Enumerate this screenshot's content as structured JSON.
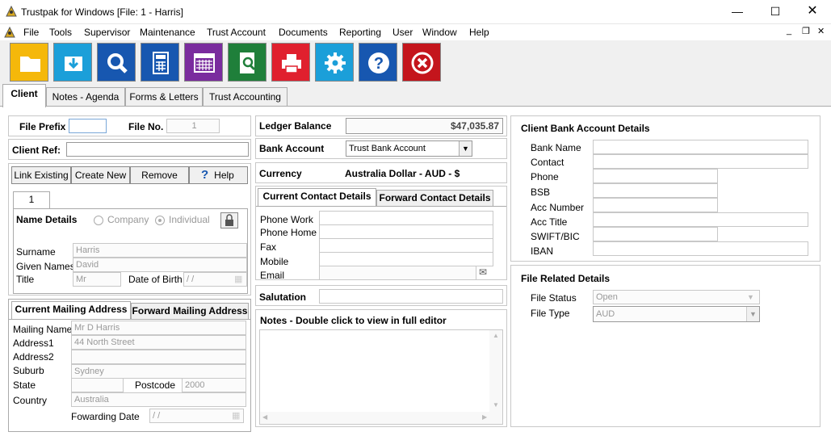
{
  "window": {
    "title": "Trustpak for Windows [File: 1 - Harris]"
  },
  "menu": [
    "File",
    "Tools",
    "Supervisor",
    "Maintenance",
    "Trust Account",
    "Documents",
    "Reporting",
    "User",
    "Window",
    "Help"
  ],
  "toolbar_icons": [
    "open-folder-icon",
    "download-icon",
    "search-icon",
    "calculator-icon",
    "calendar-icon",
    "document-search-icon",
    "printer-icon",
    "settings-icon",
    "help-icon",
    "exit-icon"
  ],
  "tabs": [
    "Client",
    "Notes - Agenda",
    "Forms & Letters",
    "Trust Accounting"
  ],
  "client": {
    "file_prefix_label": "File Prefix",
    "file_prefix": "",
    "file_no_label": "File No.",
    "file_no": "1",
    "client_ref_label": "Client Ref:",
    "client_ref": "",
    "buttons": {
      "link": "Link Existing",
      "create": "Create New",
      "remove": "Remove",
      "help": "Help"
    },
    "name_tab": "1",
    "name_details_label": "Name Details",
    "company_label": "Company",
    "individual_label": "Individual",
    "surname_label": "Surname",
    "surname": "Harris",
    "given_label": "Given Names",
    "given": "David",
    "title_label": "Title",
    "title": "Mr",
    "dob_label": "Date of Birth",
    "dob": " /  /"
  },
  "mailing": {
    "tab_current": "Current Mailing Address",
    "tab_forward": "Forward Mailing Address",
    "name_label": "Mailing Name",
    "name": "Mr D Harris",
    "address1_label": "Address1",
    "address1": "44 North Street",
    "address2_label": "Address2",
    "address2": "",
    "suburb_label": "Suburb",
    "suburb": "Sydney",
    "state_label": "State",
    "state": "",
    "postcode_label": "Postcode",
    "postcode": "2000",
    "country_label": "Country",
    "country": "Australia",
    "fwd_date_label": "Fowarding Date",
    "fwd_date": " /  /"
  },
  "ledger": {
    "balance_label": "Ledger Balance",
    "balance": "$47,035.87",
    "bank_label": "Bank Account",
    "bank": "Trust Bank Account",
    "currency_label": "Currency",
    "currency": "Australia Dollar - AUD - $"
  },
  "contact": {
    "tab_current": "Current Contact Details",
    "tab_forward": "Forward Contact Details",
    "phone_work_label": "Phone Work",
    "phone_home_label": "Phone Home",
    "fax_label": "Fax",
    "mobile_label": "Mobile",
    "email_label": "Email"
  },
  "salutation_label": "Salutation",
  "salutation": "",
  "notes_label": "Notes - Double click to view in full editor",
  "bank": {
    "title": "Client Bank Account Details",
    "bank_name_label": "Bank Name",
    "contact_label": "Contact",
    "phone_label": "Phone",
    "bsb_label": "BSB",
    "acc_number_label": "Acc Number",
    "acc_title_label": "Acc Title",
    "swift_label": "SWIFT/BIC",
    "iban_label": "IBAN"
  },
  "file_related": {
    "title": "File Related Details",
    "status_label": "File Status",
    "status": "Open",
    "type_label": "File Type",
    "type": "AUD"
  }
}
